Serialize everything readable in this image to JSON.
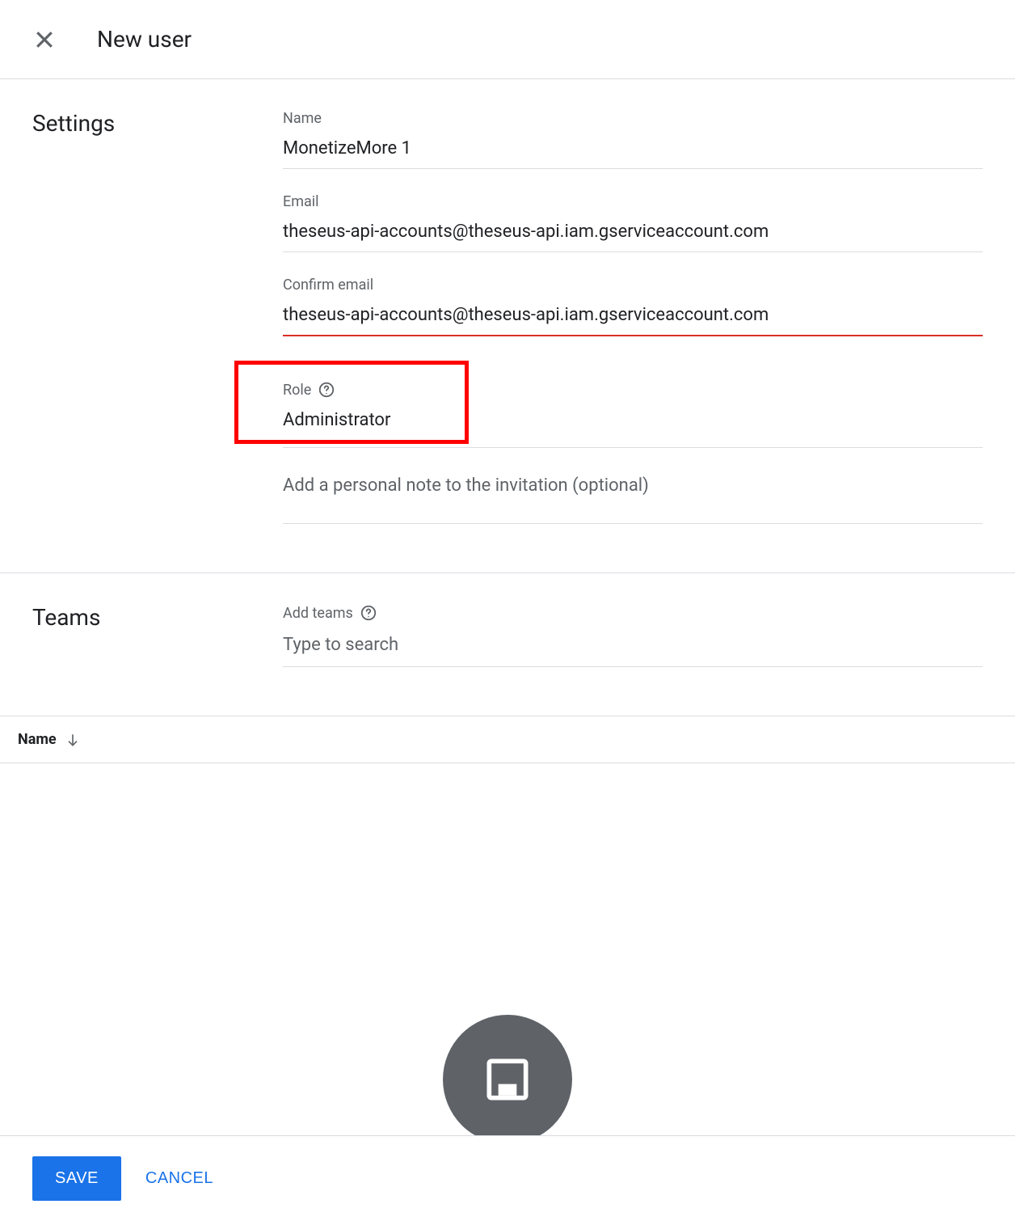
{
  "header": {
    "title": "New user"
  },
  "settings": {
    "section_title": "Settings",
    "name": {
      "label": "Name",
      "value": "MonetizeMore 1"
    },
    "email": {
      "label": "Email",
      "value": "theseus-api-accounts@theseus-api.iam.gserviceaccount.com"
    },
    "confirm_email": {
      "label": "Confirm email",
      "value": "theseus-api-accounts@theseus-api.iam.gserviceaccount.com"
    },
    "role": {
      "label": "Role",
      "value": "Administrator"
    },
    "note": {
      "placeholder": "Add a personal note to the invitation (optional)"
    }
  },
  "teams": {
    "section_title": "Teams",
    "add_label": "Add teams",
    "search_placeholder": "Type to search"
  },
  "table": {
    "column_name": "Name"
  },
  "footer": {
    "save_label": "SAVE",
    "cancel_label": "CANCEL"
  }
}
